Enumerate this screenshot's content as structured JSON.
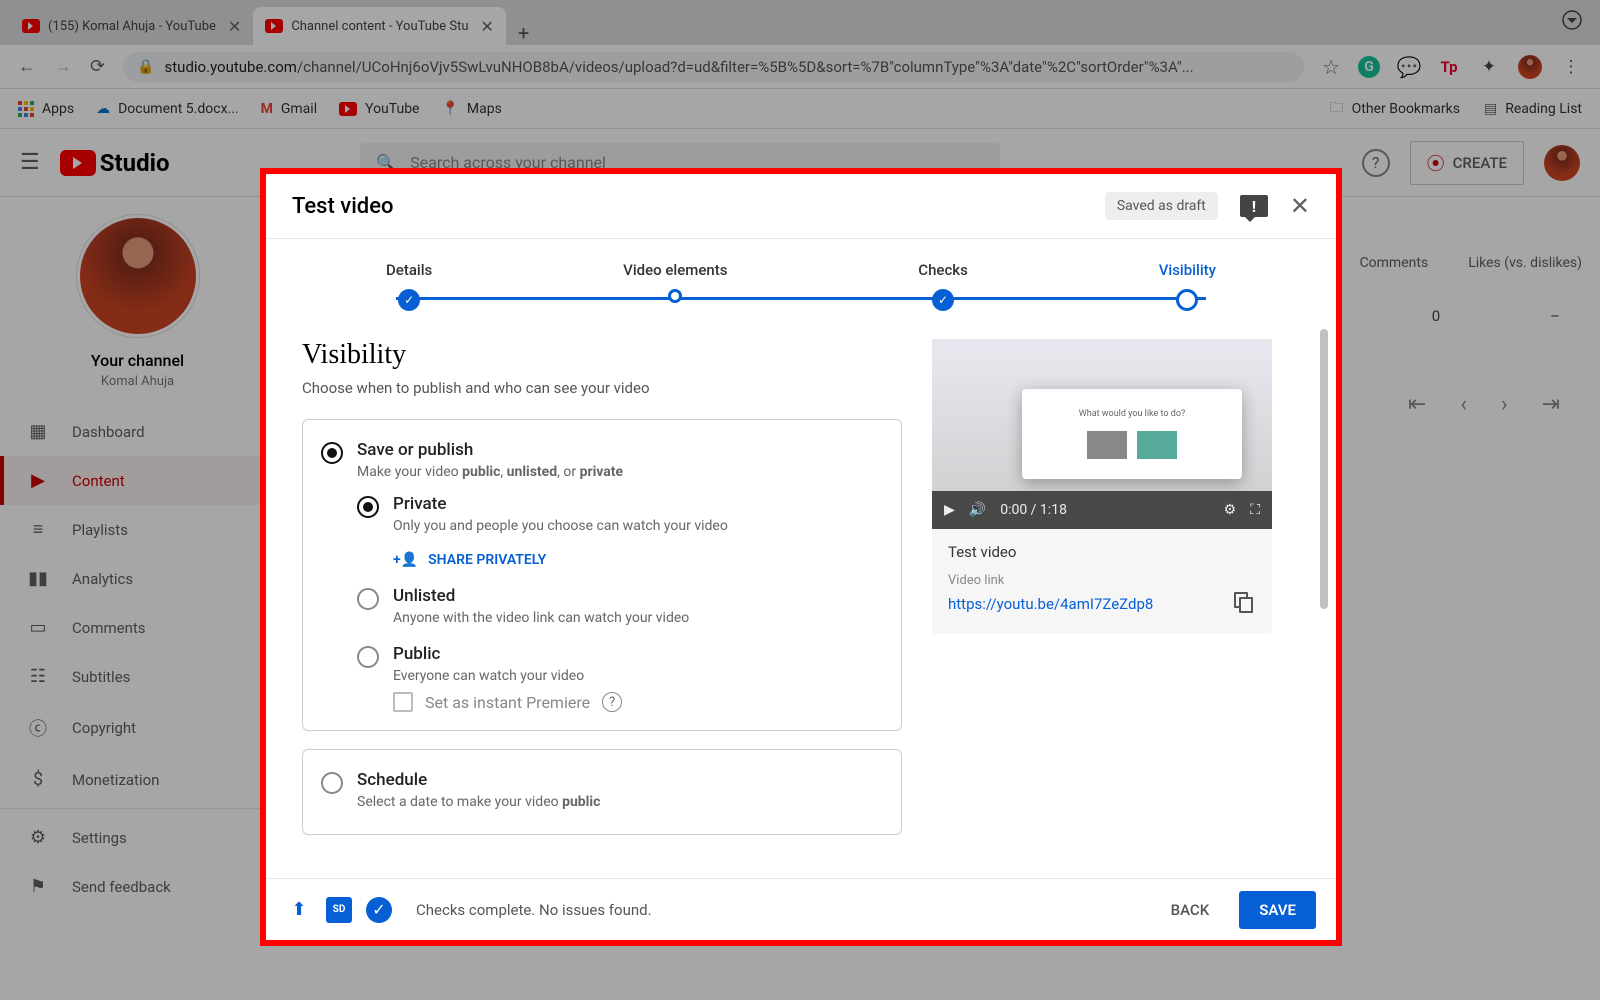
{
  "browser": {
    "tabs": [
      {
        "label": "(155) Komal Ahuja - YouTube"
      },
      {
        "label": "Channel content - YouTube Stu"
      }
    ],
    "url_prefix": "studio.youtube.com",
    "url_rest": "/channel/UCoHnj6oVjv5SwLvuNHOB8bA/videos/upload?d=ud&filter=%5B%5D&sort=%7B\"columnType\"%3A\"date\"%2C\"sortOrder\"%3A\"..."
  },
  "bookmarks": {
    "apps": "Apps",
    "items": [
      "Document 5.docx...",
      "Gmail",
      "YouTube",
      "Maps"
    ],
    "right": [
      "Other Bookmarks",
      "Reading List"
    ]
  },
  "studio_header": {
    "logo_text": "Studio",
    "search_placeholder": "Search across your channel",
    "create": "CREATE"
  },
  "sidebar": {
    "your_channel": "Your channel",
    "owner": "Komal Ahuja",
    "items": [
      "Dashboard",
      "Content",
      "Playlists",
      "Analytics",
      "Comments",
      "Subtitles",
      "Copyright",
      "Monetization"
    ],
    "footer": [
      "Settings",
      "Send feedback"
    ]
  },
  "bg_table": {
    "cols": [
      "Comments",
      "Likes (vs. dislikes)"
    ],
    "comments_val": "0",
    "likes_val": "–"
  },
  "dialog": {
    "title": "Test video",
    "draft": "Saved as draft",
    "steps": [
      "Details",
      "Video elements",
      "Checks",
      "Visibility"
    ],
    "section_title": "Visibility",
    "section_desc": "Choose when to publish and who can see your video",
    "save_publish": {
      "title": "Save or publish",
      "desc1": "Make your video ",
      "bold1": "public",
      "desc2": ", ",
      "bold2": "unlisted",
      "desc3": ", or ",
      "bold3": "private",
      "private_title": "Private",
      "private_desc": "Only you and people you choose can watch your video",
      "share_privately": "SHARE PRIVATELY",
      "unlisted_title": "Unlisted",
      "unlisted_desc": "Anyone with the video link can watch your video",
      "public_title": "Public",
      "public_desc": "Everyone can watch your video",
      "premiere": "Set as instant Premiere"
    },
    "schedule": {
      "title": "Schedule",
      "desc1": "Select a date to make your video ",
      "bold": "public"
    },
    "preview": {
      "time": "0:00 / 1:18",
      "title": "Test video",
      "link_label": "Video link",
      "link": "https://youtu.be/4amI7ZeZdp8"
    },
    "footer": {
      "msg": "Checks complete. No issues found.",
      "back": "BACK",
      "save": "SAVE"
    }
  }
}
